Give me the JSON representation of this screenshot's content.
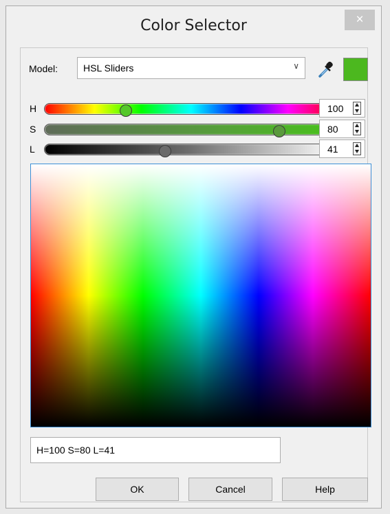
{
  "window": {
    "title": "Color Selector",
    "close_glyph": "×"
  },
  "model": {
    "label": "Model:",
    "selected": "HSL Sliders",
    "dropdown_glyph": "∨"
  },
  "current_color": "#4cb81f",
  "sliders": [
    {
      "letter": "H",
      "value": "100",
      "fraction": 0.278,
      "gradient": "linear-gradient(to right,#ff0000 0%,#ffff00 17%,#00ff00 33%,#00ffff 50%,#0000ff 67%,#ff00ff 83%,#ff0000 100%)",
      "thumb_color": "#54c829"
    },
    {
      "letter": "S",
      "value": "80",
      "fraction": 0.8,
      "gradient": "linear-gradient(to right,#5f6b59 0%,#56a03a 60%,#48c21b 100%)",
      "thumb_color": "#5a9a3d"
    },
    {
      "letter": "L",
      "value": "41",
      "fraction": 0.41,
      "gradient": "linear-gradient(to right,#000000 0%,#6f6f6f 50%,#ffffff 100%)",
      "thumb_color": "#6a6a6a"
    }
  ],
  "color_text": "H=100 S=80 L=41",
  "buttons": {
    "ok": "OK",
    "cancel": "Cancel",
    "help": "Help"
  }
}
